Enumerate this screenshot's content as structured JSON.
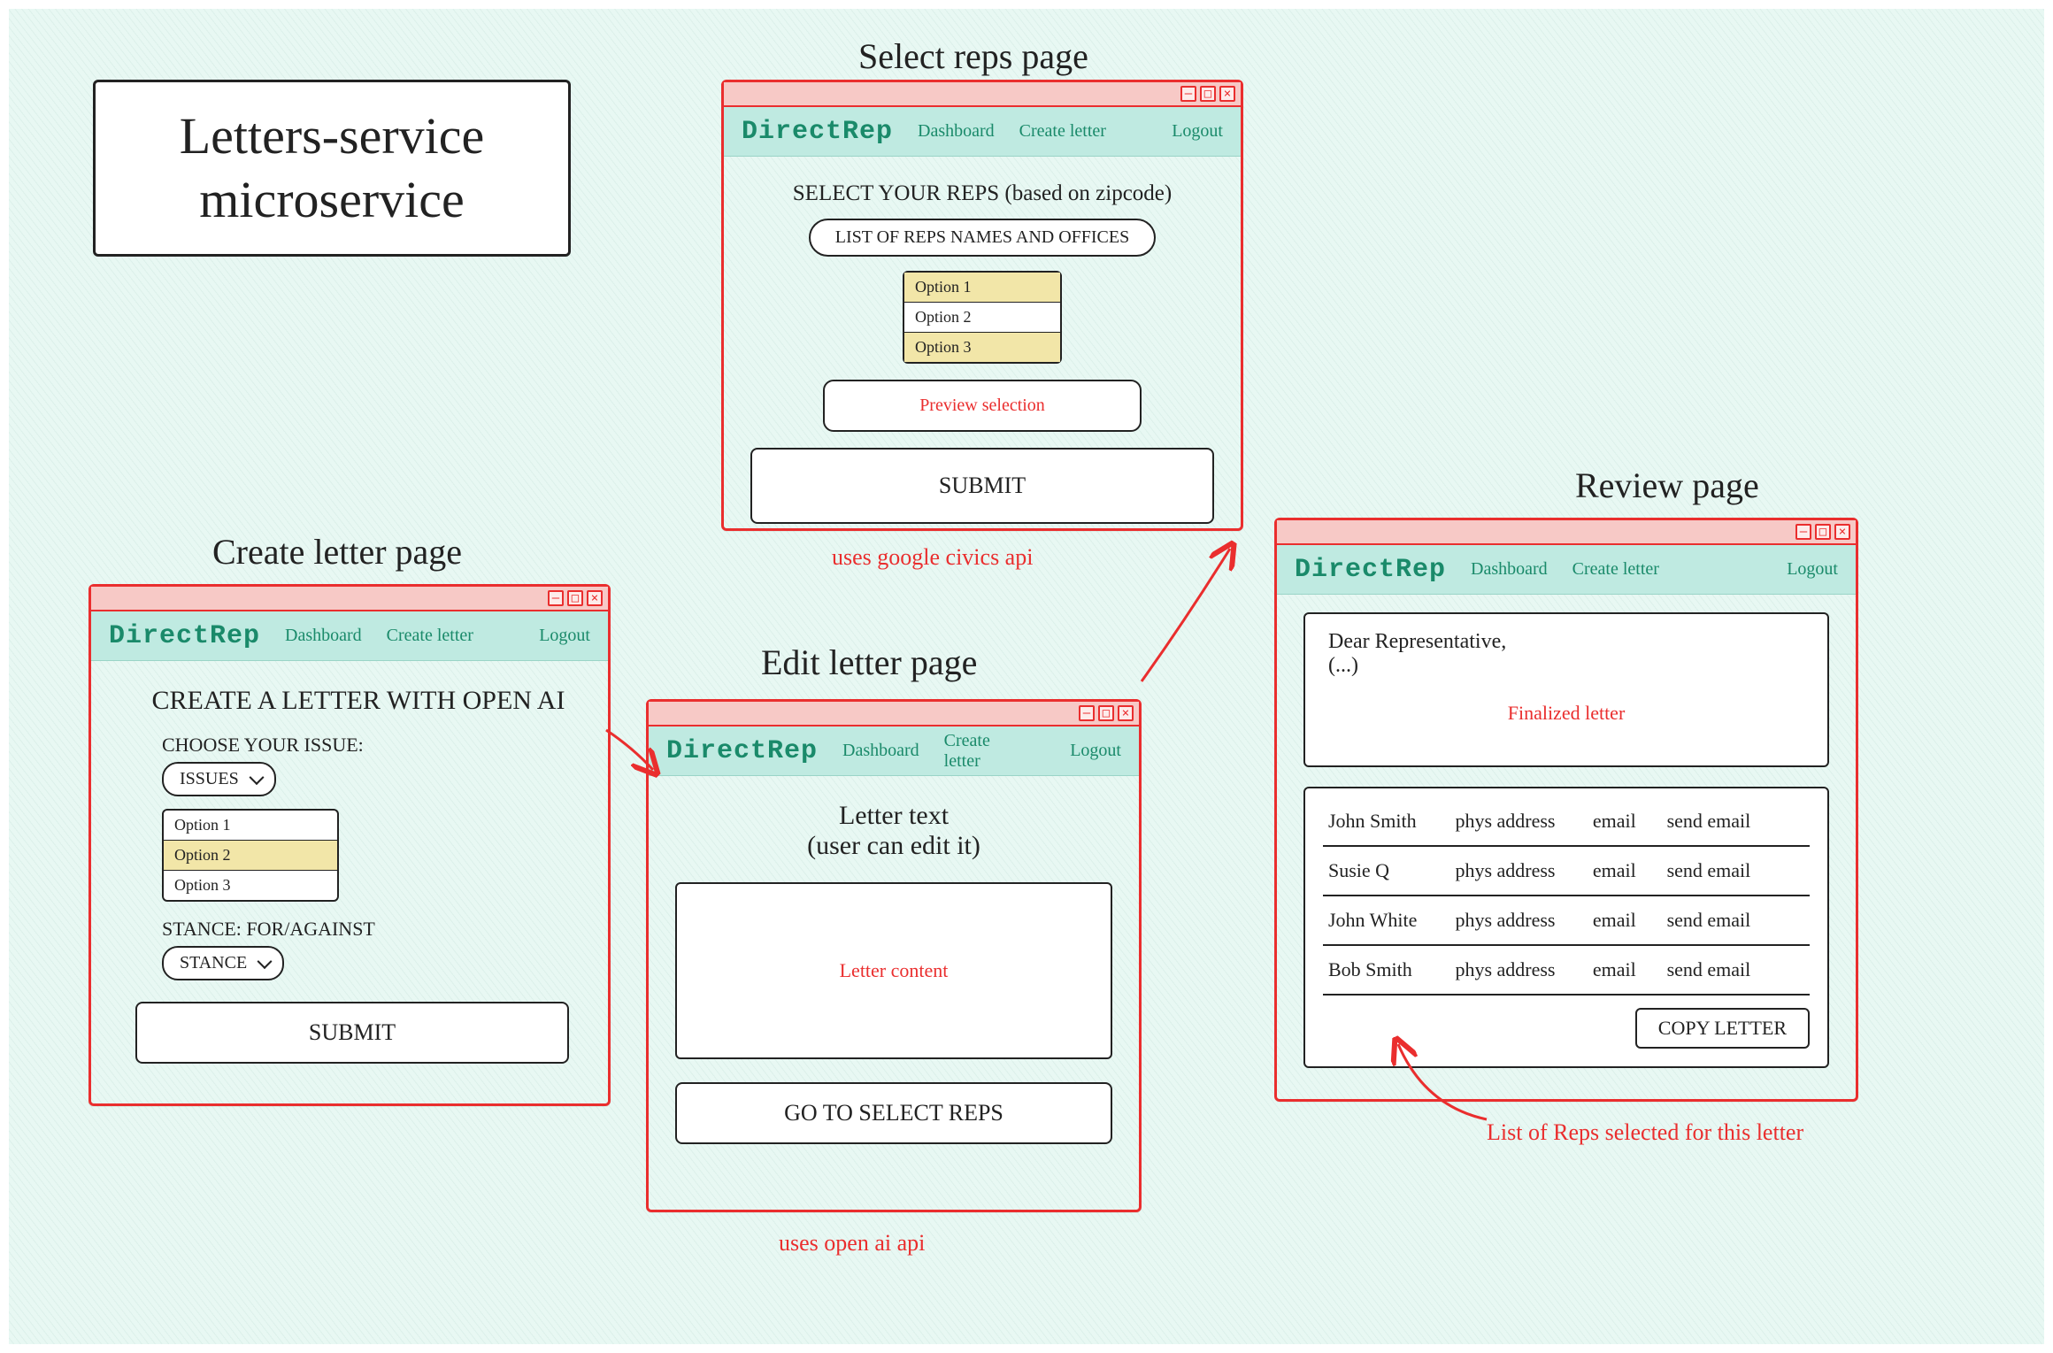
{
  "diagram_title_line1": "Letters-service",
  "diagram_title_line2": "microservice",
  "nav": {
    "brand": "DirectRep",
    "dashboard": "Dashboard",
    "create": "Create letter",
    "logout": "Logout"
  },
  "labels": {
    "select_reps_page": "Select reps page",
    "create_letter_page": "Create letter page",
    "edit_letter_page": "Edit letter page",
    "review_page": "Review page"
  },
  "annotations": {
    "uses_civics": "uses google civics api",
    "uses_openai": "uses open ai api",
    "list_of_reps": "List of Reps selected for this letter"
  },
  "create": {
    "heading": "CREATE A LETTER WITH OPEN AI",
    "choose_issue": "CHOOSE YOUR ISSUE:",
    "issues_dd": "ISSUES",
    "options": [
      "Option 1",
      "Option 2",
      "Option 3"
    ],
    "selected_option_index": 1,
    "stance_label": "STANCE: FOR/AGAINST",
    "stance_dd": "STANCE",
    "submit": "SUBMIT"
  },
  "selectreps": {
    "heading": "SELECT YOUR REPS (based on zipcode)",
    "list_box": "LIST OF REPS NAMES AND OFFICES",
    "options": [
      "Option 1",
      "Option 2",
      "Option 3"
    ],
    "selected_option_indices": [
      0,
      2
    ],
    "preview": "Preview selection",
    "submit": "SUBMIT"
  },
  "edit": {
    "heading_line1": "Letter text",
    "heading_line2": "(user can edit it)",
    "placeholder": "Letter content",
    "go_btn": "GO TO SELECT REPS"
  },
  "review": {
    "greeting": "Dear Representative,",
    "body": "(...)",
    "placeholder": "Finalized letter",
    "reps": [
      {
        "name": "John Smith",
        "addr": "phys address",
        "email": "email",
        "action": "send email"
      },
      {
        "name": "Susie Q",
        "addr": "phys address",
        "email": "email",
        "action": "send email"
      },
      {
        "name": "John White",
        "addr": "phys address",
        "email": "email",
        "action": "send email"
      },
      {
        "name": "Bob Smith",
        "addr": "phys address",
        "email": "email",
        "action": "send email"
      }
    ],
    "copy_btn": "COPY LETTER"
  }
}
